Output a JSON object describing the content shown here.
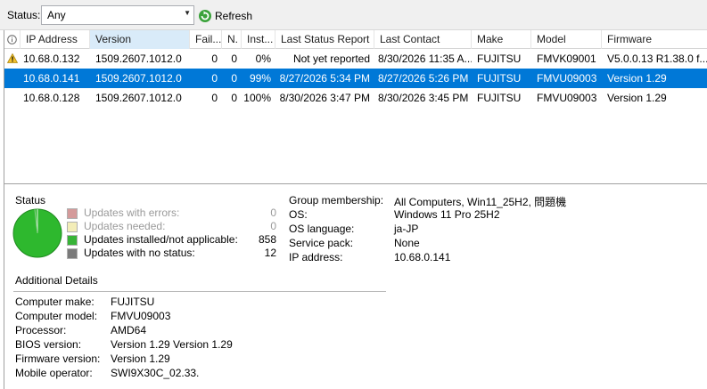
{
  "toolbar": {
    "status_label": "Status:",
    "status_value": "Any",
    "refresh_label": "Refresh"
  },
  "grid": {
    "columns": [
      "IP Address",
      "Version",
      "Fail...",
      "N.",
      "Inst...",
      "Last Status Report",
      "Last Contact",
      "Make",
      "Model",
      "Firmware"
    ],
    "rows": [
      {
        "warning": true,
        "selected": false,
        "cells": [
          "10.68.0.132",
          "1509.2607.1012.0",
          "0",
          "0",
          "0%",
          "Not yet reported",
          "8/30/2026 11:35 A...",
          "FUJITSU",
          "FMVK09001",
          "V5.0.0.13 R1.38.0 f..."
        ]
      },
      {
        "warning": false,
        "selected": true,
        "cells": [
          "10.68.0.141",
          "1509.2607.1012.0",
          "0",
          "0",
          "99%",
          "8/27/2026 5:34 PM",
          "8/27/2026 5:26 PM",
          "FUJITSU",
          "FMVU09003",
          "Version 1.29"
        ]
      },
      {
        "warning": false,
        "selected": false,
        "cells": [
          "10.68.0.128",
          "1509.2607.1012.0",
          "0",
          "0",
          "100%",
          "8/30/2026 3:47 PM",
          "8/30/2026 3:45 PM",
          "FUJITSU",
          "FMVU09003",
          "Version 1.29"
        ]
      }
    ]
  },
  "status_panel": {
    "title": "Status",
    "legend": [
      {
        "label": "Updates with errors:",
        "count": "0",
        "color": "#d49a9a",
        "muted": true
      },
      {
        "label": "Updates needed:",
        "count": "0",
        "color": "#f3edb8",
        "muted": true
      },
      {
        "label": "Updates installed/not applicable:",
        "count": "858",
        "color": "#37b337",
        "muted": false
      },
      {
        "label": "Updates with no status:",
        "count": "12",
        "color": "#7a7a7a",
        "muted": false
      }
    ]
  },
  "computer_info": [
    {
      "label": "Group membership:",
      "value": "All Computers, Win11_25H2, 問題機"
    },
    {
      "label": "OS:",
      "value": "Windows 11 Pro 25H2"
    },
    {
      "label": "OS language:",
      "value": "ja-JP"
    },
    {
      "label": "Service pack:",
      "value": "None"
    },
    {
      "label": "IP address:",
      "value": "10.68.0.141"
    }
  ],
  "additional_details": {
    "title": "Additional Details",
    "items": [
      {
        "label": "Computer make:",
        "value": "FUJITSU"
      },
      {
        "label": "Computer model:",
        "value": "FMVU09003"
      },
      {
        "label": "Processor:",
        "value": "AMD64"
      },
      {
        "label": "BIOS version:",
        "value": "Version 1.29 Version 1.29"
      },
      {
        "label": "Firmware version:",
        "value": "Version 1.29"
      },
      {
        "label": "Mobile operator:",
        "value": "SWI9X30C_02.33."
      }
    ]
  },
  "colors": {
    "selection": "#0078d7",
    "active_header": "#d9ebf9",
    "pie_green": "#2eb82e"
  }
}
